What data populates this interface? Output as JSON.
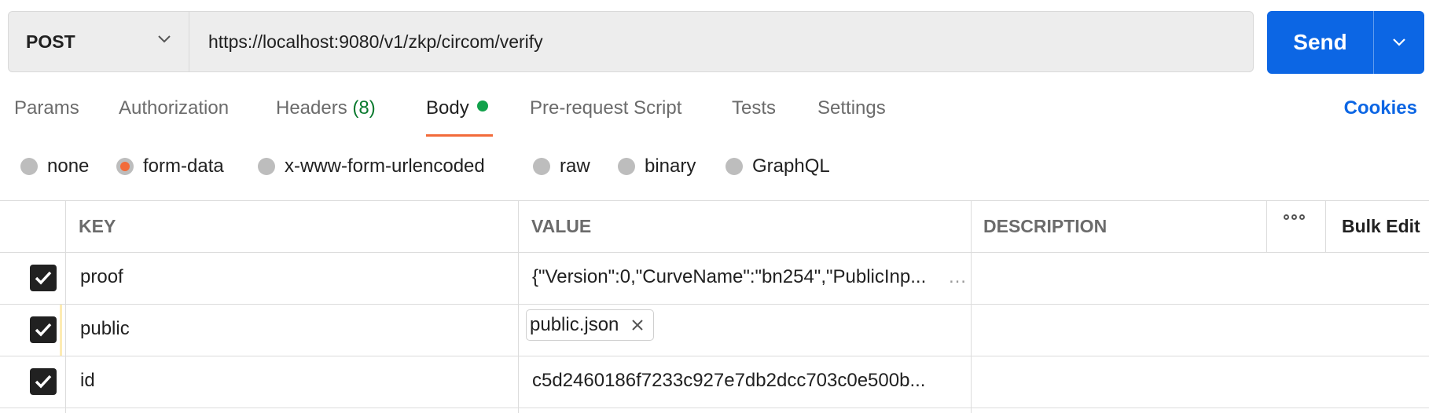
{
  "request": {
    "method": "POST",
    "url": "https://localhost:9080/v1/zkp/circom/verify",
    "send_label": "Send"
  },
  "tabs": [
    {
      "label": "Params"
    },
    {
      "label": "Authorization"
    },
    {
      "label": "Headers",
      "count": "(8)"
    },
    {
      "label": "Body",
      "active": true
    },
    {
      "label": "Pre-request Script"
    },
    {
      "label": "Tests"
    },
    {
      "label": "Settings"
    }
  ],
  "cookies_label": "Cookies",
  "body_types": [
    {
      "label": "none"
    },
    {
      "label": "form-data",
      "selected": true
    },
    {
      "label": "x-www-form-urlencoded"
    },
    {
      "label": "raw"
    },
    {
      "label": "binary"
    },
    {
      "label": "GraphQL"
    }
  ],
  "table": {
    "headers": {
      "key": "KEY",
      "value": "VALUE",
      "description": "DESCRIPTION",
      "bulk_edit": "Bulk Edit"
    },
    "rows": [
      {
        "checked": true,
        "key": "proof",
        "value": "{\"Version\":0,\"CurveName\":\"bn254\",\"PublicInp...",
        "value_type": "text"
      },
      {
        "checked": true,
        "key": "public",
        "value": "public.json",
        "value_type": "file"
      },
      {
        "checked": true,
        "key": "id",
        "value": "c5d2460186f7233c927e7db2dcc703c0e500b...",
        "value_type": "text"
      }
    ]
  },
  "colors": {
    "accent": "#0c66e4",
    "tab_underline": "#f26b3a",
    "body_dot": "#12a14b",
    "count_green": "#0b7a2f"
  }
}
